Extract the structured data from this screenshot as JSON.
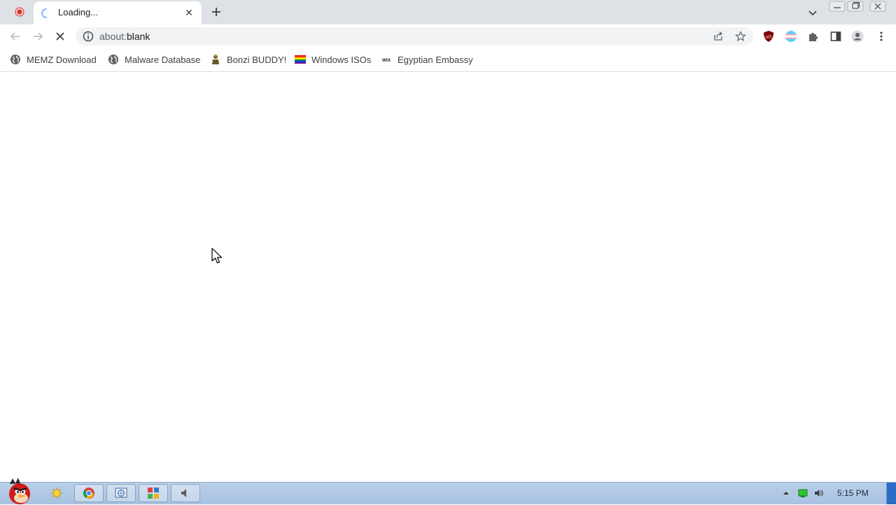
{
  "browser": {
    "tab": {
      "title": "Loading...",
      "loading": true
    },
    "address": {
      "scheme": "about:",
      "path": "blank"
    },
    "bookmarks": [
      {
        "label": "MEMZ Download",
        "icon": "globe-icon"
      },
      {
        "label": "Malware Database",
        "icon": "globe-icon"
      },
      {
        "label": "Bonzi BUDDY!",
        "icon": "bonzi-icon"
      },
      {
        "label": "Windows ISOs",
        "icon": "rainbow-flag-icon"
      },
      {
        "label": "Egyptian Embassy",
        "icon": "wix-icon",
        "icon_text": "WIX"
      }
    ]
  },
  "taskbar": {
    "clock": "5:15 PM"
  },
  "colors": {
    "tabstrip": "#dee1e6",
    "omnibox": "#f1f3f4",
    "taskbar": "#b9d0ea",
    "accent_blue": "#1a73e8"
  }
}
